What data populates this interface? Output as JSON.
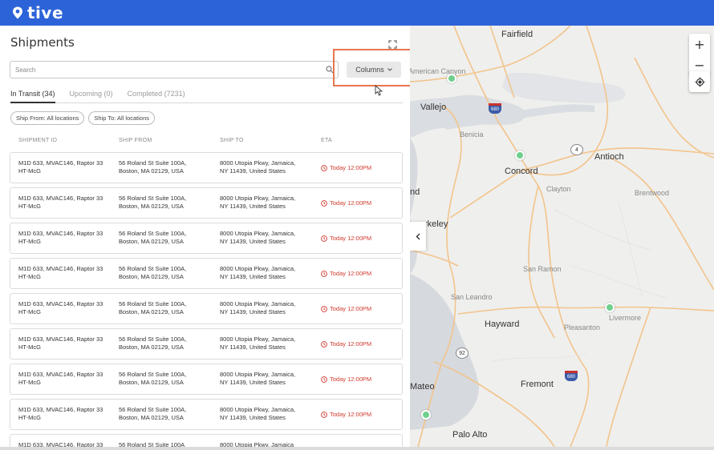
{
  "app": {
    "brand": "tive"
  },
  "header": {
    "title": "Shipments"
  },
  "search": {
    "placeholder": "Search"
  },
  "toolbar": {
    "columns_label": "Columns"
  },
  "tabs": [
    {
      "label": "In Transit (34)",
      "active": true
    },
    {
      "label": "Upcoming (0)",
      "active": false
    },
    {
      "label": "Completed (7231)",
      "active": false
    }
  ],
  "filters": [
    {
      "label": "Ship From: All locations"
    },
    {
      "label": "Ship To: All locations"
    }
  ],
  "table": {
    "columns": [
      "SHIPMENT ID",
      "SHIP FROM",
      "SHIP TO",
      "ETA"
    ],
    "rows": [
      {
        "id_line1": "M1D 633, MVAC146, Raptor 33",
        "id_line2": "HT-McG",
        "from_line1": "56 Roland St Suite 100A,",
        "from_line2": "Boston, MA 02129, USA",
        "to_line1": "8000 Utopia Pkwy, Jamaica,",
        "to_line2": "NY 11439, United States",
        "eta": "Today 12:00PM"
      },
      {
        "id_line1": "M1D 633, MVAC146, Raptor 33",
        "id_line2": "HT-McG",
        "from_line1": "56 Roland St Suite 100A,",
        "from_line2": "Boston, MA 02129, USA",
        "to_line1": "8000 Utopia Pkwy, Jamaica,",
        "to_line2": "NY 11439, United States",
        "eta": "Today 12:00PM"
      },
      {
        "id_line1": "M1D 633, MVAC146, Raptor 33",
        "id_line2": "HT-McG",
        "from_line1": "56 Roland St Suite 100A,",
        "from_line2": "Boston, MA 02129, USA",
        "to_line1": "8000 Utopia Pkwy, Jamaica,",
        "to_line2": "NY 11439, United States",
        "eta": "Today 12:00PM"
      },
      {
        "id_line1": "M1D 633, MVAC146, Raptor 33",
        "id_line2": "HT-McG",
        "from_line1": "56 Roland St Suite 100A,",
        "from_line2": "Boston, MA 02129, USA",
        "to_line1": "8000 Utopia Pkwy, Jamaica,",
        "to_line2": "NY 11439, United States",
        "eta": "Today 12:00PM"
      },
      {
        "id_line1": "M1D 633, MVAC146, Raptor 33",
        "id_line2": "HT-McG",
        "from_line1": "56 Roland St Suite 100A,",
        "from_line2": "Boston, MA 02129, USA",
        "to_line1": "8000 Utopia Pkwy, Jamaica,",
        "to_line2": "NY 11439, United States",
        "eta": "Today 12:00PM"
      },
      {
        "id_line1": "M1D 633, MVAC146, Raptor 33",
        "id_line2": "HT-McG",
        "from_line1": "56 Roland St Suite 100A,",
        "from_line2": "Boston, MA 02129, USA",
        "to_line1": "8000 Utopia Pkwy, Jamaica,",
        "to_line2": "NY 11439, United States",
        "eta": "Today 12:00PM"
      },
      {
        "id_line1": "M1D 633, MVAC146, Raptor 33",
        "id_line2": "HT-McG",
        "from_line1": "56 Roland St Suite 100A,",
        "from_line2": "Boston, MA 02129, USA",
        "to_line1": "8000 Utopia Pkwy, Jamaica,",
        "to_line2": "NY 11439, United States",
        "eta": "Today 12:00PM"
      },
      {
        "id_line1": "M1D 633, MVAC146, Raptor 33",
        "id_line2": "HT-McG",
        "from_line1": "56 Roland St Suite 100A,",
        "from_line2": "Boston, MA 02129, USA",
        "to_line1": "8000 Utopia Pkwy, Jamaica,",
        "to_line2": "NY 11439, United States",
        "eta": "Today 12:00PM"
      },
      {
        "id_line1": "M1D 633, MVAC146, Raptor 33",
        "id_line2": "",
        "from_line1": "56 Roland St Suite 100A",
        "from_line2": "",
        "to_line1": "8000 Utopia Pkwy, Jamaica",
        "to_line2": "",
        "eta": ""
      }
    ]
  },
  "map": {
    "zoom_in": "+",
    "zoom_out": "−",
    "labels": {
      "fairfield": "Fairfield",
      "american_canyon": "American Canyon",
      "vallejo": "Vallejo",
      "benicia": "Benicia",
      "antioch": "Antioch",
      "concord": "Concord",
      "clayton": "Clayton",
      "brentwood": "Brentwood",
      "oakland_fragment": "nd",
      "berkeley": "rkeley",
      "san_ramon": "San Ramon",
      "san_leandro": "San Leandro",
      "hayward": "Hayward",
      "pleasanton": "Pleasanton",
      "livermore": "Livermore",
      "mateo": "Mateo",
      "fremont": "Fremont",
      "palo_alto": "Palo Alto"
    },
    "shields": {
      "i680_top": "680",
      "r4": "4",
      "r92": "92",
      "i680_bottom": "680"
    }
  },
  "colors": {
    "brand": "#2d63d8",
    "eta": "#d03a2e",
    "highlight": "#e8764c",
    "pin": "#6fd08e"
  }
}
